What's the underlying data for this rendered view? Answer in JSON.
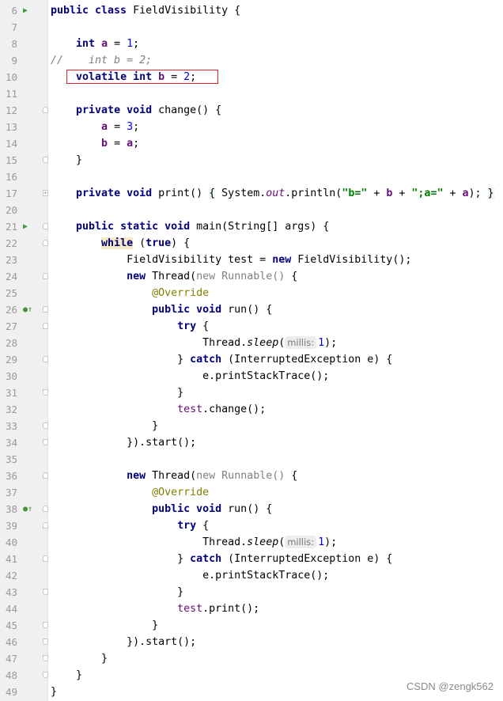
{
  "editor": {
    "lines": [
      {
        "num": "6",
        "marker": "run",
        "fold": "",
        "tokens": [
          [
            "public class ",
            "k"
          ],
          [
            "FieldVisibility {",
            "p"
          ]
        ]
      },
      {
        "num": "7",
        "marker": "",
        "fold": "",
        "tokens": []
      },
      {
        "num": "8",
        "marker": "",
        "fold": "",
        "tokens": [
          [
            "    ",
            "p"
          ],
          [
            "int ",
            "k"
          ],
          [
            "a",
            "f"
          ],
          [
            " = ",
            "p"
          ],
          [
            "1",
            "n"
          ],
          [
            ";",
            "p"
          ]
        ]
      },
      {
        "num": "9",
        "marker": "",
        "fold": "",
        "tokens": [
          [
            "//    int b = 2;",
            "cm"
          ]
        ]
      },
      {
        "num": "10",
        "marker": "",
        "fold": "",
        "tokens": [
          [
            "    ",
            "p"
          ],
          [
            "volatile int ",
            "k"
          ],
          [
            "b",
            "f"
          ],
          [
            " = ",
            "p"
          ],
          [
            "2",
            "n"
          ],
          [
            ";",
            "p"
          ]
        ]
      },
      {
        "num": "11",
        "marker": "",
        "fold": "",
        "tokens": []
      },
      {
        "num": "12",
        "marker": "",
        "fold": "start",
        "tokens": [
          [
            "    ",
            "p"
          ],
          [
            "private void ",
            "k"
          ],
          [
            "change() {",
            "p"
          ]
        ]
      },
      {
        "num": "13",
        "marker": "",
        "fold": "",
        "tokens": [
          [
            "        ",
            "p"
          ],
          [
            "a",
            "f"
          ],
          [
            " = ",
            "p"
          ],
          [
            "3",
            "n"
          ],
          [
            ";",
            "p"
          ]
        ]
      },
      {
        "num": "14",
        "marker": "",
        "fold": "",
        "tokens": [
          [
            "        ",
            "p"
          ],
          [
            "b",
            "f"
          ],
          [
            " = ",
            "p"
          ],
          [
            "a",
            "f"
          ],
          [
            ";",
            "p"
          ]
        ]
      },
      {
        "num": "15",
        "marker": "",
        "fold": "end",
        "tokens": [
          [
            "    }",
            "p"
          ]
        ]
      },
      {
        "num": "16",
        "marker": "",
        "fold": "",
        "tokens": []
      },
      {
        "num": "17",
        "marker": "",
        "fold": "plus",
        "tokens": [
          [
            "    ",
            "p"
          ],
          [
            "private void ",
            "k"
          ],
          [
            "print() ",
            "p"
          ],
          [
            "{",
            "br"
          ],
          [
            " System.",
            "p"
          ],
          [
            "out",
            "stf"
          ],
          [
            ".println(",
            "p"
          ],
          [
            "\"b=\"",
            "s"
          ],
          [
            " + ",
            "p"
          ],
          [
            "b",
            "f"
          ],
          [
            " + ",
            "p"
          ],
          [
            "\";a=\"",
            "s"
          ],
          [
            " + ",
            "p"
          ],
          [
            "a",
            "f"
          ],
          [
            "); ",
            "p"
          ],
          [
            "}",
            "br"
          ]
        ]
      },
      {
        "num": "20",
        "marker": "",
        "fold": "",
        "tokens": []
      },
      {
        "num": "21",
        "marker": "run",
        "fold": "start",
        "tokens": [
          [
            "    ",
            "p"
          ],
          [
            "public static void ",
            "k"
          ],
          [
            "main(String[] args) {",
            "p"
          ]
        ]
      },
      {
        "num": "22",
        "marker": "",
        "fold": "start",
        "tokens": [
          [
            "        ",
            "p"
          ],
          [
            "while",
            "k hl"
          ],
          [
            " (",
            "p"
          ],
          [
            "true",
            "k"
          ],
          [
            ") {",
            "p"
          ]
        ]
      },
      {
        "num": "23",
        "marker": "",
        "fold": "",
        "tokens": [
          [
            "            FieldVisibility test = ",
            "p"
          ],
          [
            "new ",
            "k"
          ],
          [
            "FieldVisibility();",
            "p"
          ]
        ]
      },
      {
        "num": "24",
        "marker": "",
        "fold": "start",
        "tokens": [
          [
            "            ",
            "p"
          ],
          [
            "new ",
            "k"
          ],
          [
            "Thread(",
            "p"
          ],
          [
            "new Runnable()",
            "g"
          ],
          [
            " {",
            "p"
          ]
        ]
      },
      {
        "num": "25",
        "marker": "",
        "fold": "",
        "tokens": [
          [
            "                ",
            "p"
          ],
          [
            "@Override",
            "an"
          ]
        ]
      },
      {
        "num": "26",
        "marker": "override",
        "fold": "start",
        "tokens": [
          [
            "                ",
            "p"
          ],
          [
            "public void ",
            "k"
          ],
          [
            "run() {",
            "p"
          ]
        ]
      },
      {
        "num": "27",
        "marker": "",
        "fold": "start",
        "tokens": [
          [
            "                    ",
            "p"
          ],
          [
            "try ",
            "k"
          ],
          [
            "{",
            "p"
          ]
        ]
      },
      {
        "num": "28",
        "marker": "",
        "fold": "",
        "tokens": [
          [
            "                        Thread.",
            "p"
          ],
          [
            "sleep",
            "st"
          ],
          [
            "(",
            "p"
          ],
          [
            "millis:",
            "h"
          ],
          [
            "1",
            "n"
          ],
          [
            ");",
            "p"
          ]
        ]
      },
      {
        "num": "29",
        "marker": "",
        "fold": "start",
        "tokens": [
          [
            "                    } ",
            "p"
          ],
          [
            "catch ",
            "k"
          ],
          [
            "(InterruptedException e) {",
            "p"
          ]
        ]
      },
      {
        "num": "30",
        "marker": "",
        "fold": "",
        "tokens": [
          [
            "                        e.printStackTrace();",
            "p"
          ]
        ]
      },
      {
        "num": "31",
        "marker": "",
        "fold": "end",
        "tokens": [
          [
            "                    }",
            "p"
          ]
        ]
      },
      {
        "num": "32",
        "marker": "",
        "fold": "",
        "tokens": [
          [
            "                    ",
            "p"
          ],
          [
            "test",
            "tv"
          ],
          [
            ".change();",
            "p"
          ]
        ]
      },
      {
        "num": "33",
        "marker": "",
        "fold": "end",
        "tokens": [
          [
            "                }",
            "p"
          ]
        ]
      },
      {
        "num": "34",
        "marker": "",
        "fold": "end",
        "tokens": [
          [
            "            }).start();",
            "p"
          ]
        ]
      },
      {
        "num": "35",
        "marker": "",
        "fold": "",
        "tokens": []
      },
      {
        "num": "36",
        "marker": "",
        "fold": "start",
        "tokens": [
          [
            "            ",
            "p"
          ],
          [
            "new ",
            "k"
          ],
          [
            "Thread(",
            "p"
          ],
          [
            "new Runnable()",
            "g"
          ],
          [
            " {",
            "p"
          ]
        ]
      },
      {
        "num": "37",
        "marker": "",
        "fold": "",
        "tokens": [
          [
            "                ",
            "p"
          ],
          [
            "@Override",
            "an"
          ]
        ]
      },
      {
        "num": "38",
        "marker": "override",
        "fold": "start",
        "tokens": [
          [
            "                ",
            "p"
          ],
          [
            "public void ",
            "k"
          ],
          [
            "run() {",
            "p"
          ]
        ]
      },
      {
        "num": "39",
        "marker": "",
        "fold": "start",
        "tokens": [
          [
            "                    ",
            "p"
          ],
          [
            "try ",
            "k"
          ],
          [
            "{",
            "p"
          ]
        ]
      },
      {
        "num": "40",
        "marker": "",
        "fold": "",
        "tokens": [
          [
            "                        Thread.",
            "p"
          ],
          [
            "sleep",
            "st"
          ],
          [
            "(",
            "p"
          ],
          [
            "millis:",
            "h"
          ],
          [
            "1",
            "n"
          ],
          [
            ");",
            "p"
          ]
        ]
      },
      {
        "num": "41",
        "marker": "",
        "fold": "start",
        "tokens": [
          [
            "                    } ",
            "p"
          ],
          [
            "catch ",
            "k"
          ],
          [
            "(InterruptedException e) {",
            "p"
          ]
        ]
      },
      {
        "num": "42",
        "marker": "",
        "fold": "",
        "tokens": [
          [
            "                        e.printStackTrace();",
            "p"
          ]
        ]
      },
      {
        "num": "43",
        "marker": "",
        "fold": "end",
        "tokens": [
          [
            "                    }",
            "p"
          ]
        ]
      },
      {
        "num": "44",
        "marker": "",
        "fold": "",
        "tokens": [
          [
            "                    ",
            "p"
          ],
          [
            "test",
            "tv"
          ],
          [
            ".print();",
            "p"
          ]
        ]
      },
      {
        "num": "45",
        "marker": "",
        "fold": "end",
        "tokens": [
          [
            "                }",
            "p"
          ]
        ]
      },
      {
        "num": "46",
        "marker": "",
        "fold": "end",
        "tokens": [
          [
            "            }).start();",
            "p"
          ]
        ]
      },
      {
        "num": "47",
        "marker": "",
        "fold": "end",
        "tokens": [
          [
            "        }",
            "p"
          ]
        ]
      },
      {
        "num": "48",
        "marker": "",
        "fold": "end",
        "tokens": [
          [
            "    }",
            "p"
          ]
        ]
      },
      {
        "num": "49",
        "marker": "",
        "fold": "",
        "tokens": [
          [
            "}",
            "p"
          ]
        ]
      }
    ],
    "highlight_box_color": "#e0262b"
  },
  "watermark": "CSDN @zengk562"
}
